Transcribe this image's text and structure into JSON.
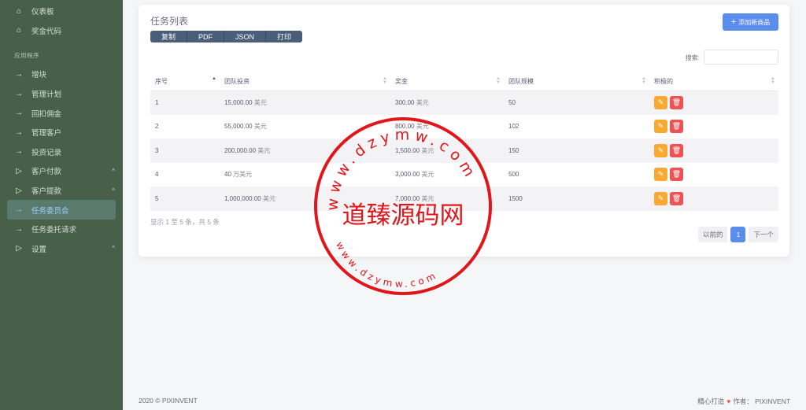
{
  "sidebar": {
    "top_items": [
      {
        "label": "仪表板",
        "icon": "home-icon"
      },
      {
        "label": "奖金代码",
        "icon": "home-icon"
      }
    ],
    "section_label": "应用程序",
    "items": [
      {
        "label": "增块",
        "icon": "arrow-right-icon",
        "chevron": ""
      },
      {
        "label": "管理计划",
        "icon": "arrow-right-icon",
        "chevron": ""
      },
      {
        "label": "回扣佣金",
        "icon": "arrow-right-icon",
        "chevron": ""
      },
      {
        "label": "管理客户",
        "icon": "arrow-right-icon",
        "chevron": ""
      },
      {
        "label": "投资记录",
        "icon": "arrow-right-icon",
        "chevron": ""
      },
      {
        "label": "客户付款",
        "icon": "play-triangle-icon",
        "chevron": "^"
      },
      {
        "label": "客户提款",
        "icon": "play-triangle-icon",
        "chevron": "^"
      },
      {
        "label": "任务委员会",
        "icon": "arrow-right-icon",
        "chevron": "",
        "active": true
      },
      {
        "label": "任务委托请求",
        "icon": "arrow-right-icon",
        "chevron": ""
      },
      {
        "label": "设置",
        "icon": "play-triangle-icon",
        "chevron": "^"
      }
    ]
  },
  "card": {
    "title": "任务列表",
    "export_buttons": [
      "复制",
      "PDF",
      "JSON",
      "打印"
    ],
    "add_button": "添加新商品",
    "search_label": "搜索:",
    "search_value": "",
    "columns": [
      "序号",
      "团队投资",
      "奖金",
      "团队规模",
      "积极的"
    ],
    "rows": [
      {
        "no": "1",
        "investment": "15,000.00",
        "inv_unit": "美元",
        "bonus": "300.00",
        "bonus_unit": "美元",
        "size": "50"
      },
      {
        "no": "2",
        "investment": "55,000.00",
        "inv_unit": "美元",
        "bonus": "800.00",
        "bonus_unit": "美元",
        "size": "102"
      },
      {
        "no": "3",
        "investment": "200,000.00",
        "inv_unit": "美元",
        "bonus": "1,500.00",
        "bonus_unit": "美元",
        "size": "150"
      },
      {
        "no": "4",
        "investment": "40",
        "inv_unit": "万美元",
        "bonus": "3,000.00",
        "bonus_unit": "美元",
        "size": "500"
      },
      {
        "no": "5",
        "investment": "1,000,000.00",
        "inv_unit": "美元",
        "bonus": "7,000.00",
        "bonus_unit": "美元",
        "size": "1500"
      }
    ],
    "info": "显示 1 至 5 条，共 5 条",
    "pager": {
      "prev": "以前的",
      "current": "1",
      "next": "下一个"
    }
  },
  "footer": {
    "left": "2020 © PIXINVENT",
    "right_prefix": "精心打造",
    "right_suffix": "作者：  PIXINVENT"
  },
  "watermark": {
    "text_center": "道臻源码网",
    "text_ring_top": "www.dzymw.com",
    "text_ring_bottom": "www.dzymw.com",
    "color": "#e0161b"
  }
}
